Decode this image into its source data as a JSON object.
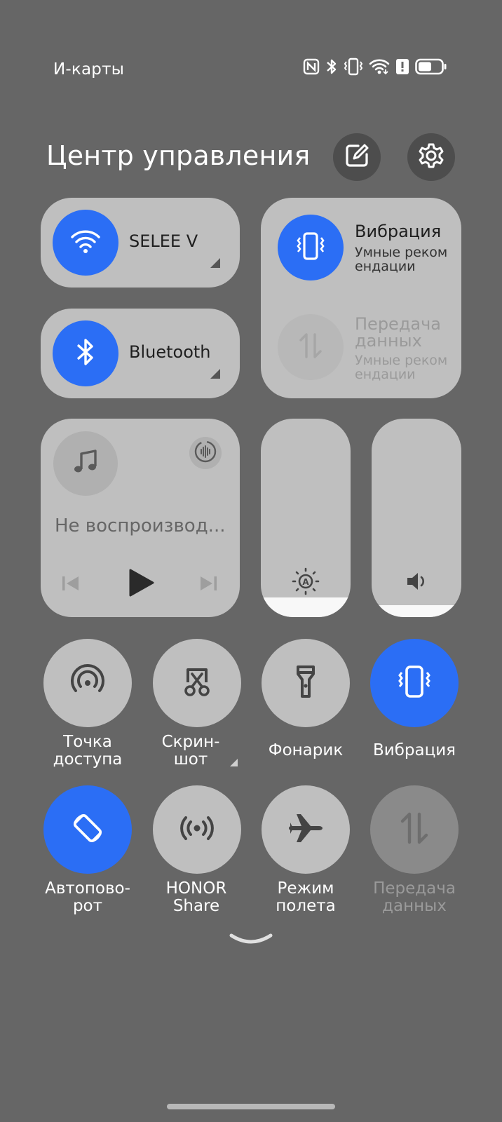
{
  "status_bar": {
    "carrier_text": "И-карты",
    "icons": [
      "nfc-icon",
      "bluetooth-icon",
      "vibrate-icon",
      "wifi-icon",
      "alert-icon",
      "battery-icon"
    ]
  },
  "header": {
    "title": "Центр управления",
    "edit_icon": "edit-icon",
    "settings_icon": "settings-icon"
  },
  "tiles": {
    "wifi": {
      "label": "SELEE V",
      "icon": "wifi-icon",
      "active": true
    },
    "bluetooth": {
      "label": "Bluetooth",
      "icon": "bluetooth-icon",
      "active": true
    },
    "vibration": {
      "title": "Вибрация",
      "subtitle": "Умные реком ендации",
      "icon": "vibrate-icon",
      "active": true
    },
    "data": {
      "title": "Передача данных",
      "subtitle": "Умные реком ендации",
      "icon": "data-transfer-icon",
      "active": false
    }
  },
  "media": {
    "status": "Не воспроизвод...",
    "icon": "music-note-icon"
  },
  "sliders": {
    "brightness": {
      "icon": "auto-brightness-icon",
      "level": 0.1
    },
    "volume": {
      "icon": "volume-icon",
      "level": 0.06
    }
  },
  "toggles": [
    {
      "label1": "Точка",
      "label2": "доступа",
      "icon": "hotspot-icon",
      "state": "off"
    },
    {
      "label1": "Скрин-",
      "label2": "шот",
      "icon": "screenshot-icon",
      "state": "off"
    },
    {
      "label1": "Фонарик",
      "label2": "",
      "icon": "flashlight-icon",
      "state": "off"
    },
    {
      "label1": "Вибрация",
      "label2": "",
      "icon": "vibrate-icon",
      "state": "on"
    },
    {
      "label1": "Автопово-",
      "label2": "рот",
      "icon": "auto-rotate-icon",
      "state": "on"
    },
    {
      "label1": "HONOR",
      "label2": "Share",
      "icon": "honor-share-icon",
      "state": "off"
    },
    {
      "label1": "Режим",
      "label2": "полета",
      "icon": "airplane-icon",
      "state": "off"
    },
    {
      "label1": "Передача",
      "label2": "данных",
      "icon": "data-transfer-icon",
      "state": "disabled"
    }
  ],
  "colors": {
    "background": "#666666",
    "accent": "#2b6ef5",
    "tile": "#bfbfbf"
  }
}
